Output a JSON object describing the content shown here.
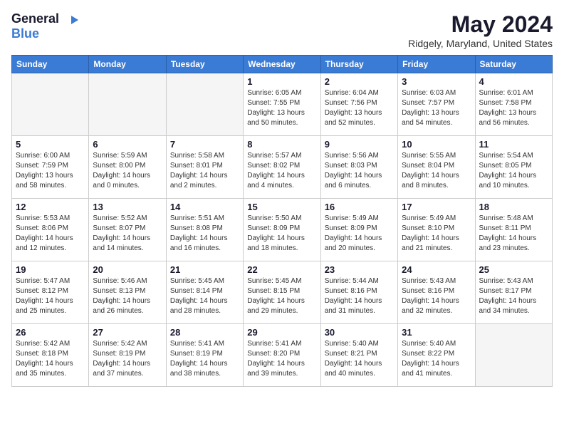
{
  "header": {
    "logo_general": "General",
    "logo_blue": "Blue",
    "title": "May 2024",
    "subtitle": "Ridgely, Maryland, United States"
  },
  "days_of_week": [
    "Sunday",
    "Monday",
    "Tuesday",
    "Wednesday",
    "Thursday",
    "Friday",
    "Saturday"
  ],
  "weeks": [
    [
      {
        "day": "",
        "sunrise": "",
        "sunset": "",
        "daylight": ""
      },
      {
        "day": "",
        "sunrise": "",
        "sunset": "",
        "daylight": ""
      },
      {
        "day": "",
        "sunrise": "",
        "sunset": "",
        "daylight": ""
      },
      {
        "day": "1",
        "sunrise": "Sunrise: 6:05 AM",
        "sunset": "Sunset: 7:55 PM",
        "daylight": "Daylight: 13 hours and 50 minutes."
      },
      {
        "day": "2",
        "sunrise": "Sunrise: 6:04 AM",
        "sunset": "Sunset: 7:56 PM",
        "daylight": "Daylight: 13 hours and 52 minutes."
      },
      {
        "day": "3",
        "sunrise": "Sunrise: 6:03 AM",
        "sunset": "Sunset: 7:57 PM",
        "daylight": "Daylight: 13 hours and 54 minutes."
      },
      {
        "day": "4",
        "sunrise": "Sunrise: 6:01 AM",
        "sunset": "Sunset: 7:58 PM",
        "daylight": "Daylight: 13 hours and 56 minutes."
      }
    ],
    [
      {
        "day": "5",
        "sunrise": "Sunrise: 6:00 AM",
        "sunset": "Sunset: 7:59 PM",
        "daylight": "Daylight: 13 hours and 58 minutes."
      },
      {
        "day": "6",
        "sunrise": "Sunrise: 5:59 AM",
        "sunset": "Sunset: 8:00 PM",
        "daylight": "Daylight: 14 hours and 0 minutes."
      },
      {
        "day": "7",
        "sunrise": "Sunrise: 5:58 AM",
        "sunset": "Sunset: 8:01 PM",
        "daylight": "Daylight: 14 hours and 2 minutes."
      },
      {
        "day": "8",
        "sunrise": "Sunrise: 5:57 AM",
        "sunset": "Sunset: 8:02 PM",
        "daylight": "Daylight: 14 hours and 4 minutes."
      },
      {
        "day": "9",
        "sunrise": "Sunrise: 5:56 AM",
        "sunset": "Sunset: 8:03 PM",
        "daylight": "Daylight: 14 hours and 6 minutes."
      },
      {
        "day": "10",
        "sunrise": "Sunrise: 5:55 AM",
        "sunset": "Sunset: 8:04 PM",
        "daylight": "Daylight: 14 hours and 8 minutes."
      },
      {
        "day": "11",
        "sunrise": "Sunrise: 5:54 AM",
        "sunset": "Sunset: 8:05 PM",
        "daylight": "Daylight: 14 hours and 10 minutes."
      }
    ],
    [
      {
        "day": "12",
        "sunrise": "Sunrise: 5:53 AM",
        "sunset": "Sunset: 8:06 PM",
        "daylight": "Daylight: 14 hours and 12 minutes."
      },
      {
        "day": "13",
        "sunrise": "Sunrise: 5:52 AM",
        "sunset": "Sunset: 8:07 PM",
        "daylight": "Daylight: 14 hours and 14 minutes."
      },
      {
        "day": "14",
        "sunrise": "Sunrise: 5:51 AM",
        "sunset": "Sunset: 8:08 PM",
        "daylight": "Daylight: 14 hours and 16 minutes."
      },
      {
        "day": "15",
        "sunrise": "Sunrise: 5:50 AM",
        "sunset": "Sunset: 8:09 PM",
        "daylight": "Daylight: 14 hours and 18 minutes."
      },
      {
        "day": "16",
        "sunrise": "Sunrise: 5:49 AM",
        "sunset": "Sunset: 8:09 PM",
        "daylight": "Daylight: 14 hours and 20 minutes."
      },
      {
        "day": "17",
        "sunrise": "Sunrise: 5:49 AM",
        "sunset": "Sunset: 8:10 PM",
        "daylight": "Daylight: 14 hours and 21 minutes."
      },
      {
        "day": "18",
        "sunrise": "Sunrise: 5:48 AM",
        "sunset": "Sunset: 8:11 PM",
        "daylight": "Daylight: 14 hours and 23 minutes."
      }
    ],
    [
      {
        "day": "19",
        "sunrise": "Sunrise: 5:47 AM",
        "sunset": "Sunset: 8:12 PM",
        "daylight": "Daylight: 14 hours and 25 minutes."
      },
      {
        "day": "20",
        "sunrise": "Sunrise: 5:46 AM",
        "sunset": "Sunset: 8:13 PM",
        "daylight": "Daylight: 14 hours and 26 minutes."
      },
      {
        "day": "21",
        "sunrise": "Sunrise: 5:45 AM",
        "sunset": "Sunset: 8:14 PM",
        "daylight": "Daylight: 14 hours and 28 minutes."
      },
      {
        "day": "22",
        "sunrise": "Sunrise: 5:45 AM",
        "sunset": "Sunset: 8:15 PM",
        "daylight": "Daylight: 14 hours and 29 minutes."
      },
      {
        "day": "23",
        "sunrise": "Sunrise: 5:44 AM",
        "sunset": "Sunset: 8:16 PM",
        "daylight": "Daylight: 14 hours and 31 minutes."
      },
      {
        "day": "24",
        "sunrise": "Sunrise: 5:43 AM",
        "sunset": "Sunset: 8:16 PM",
        "daylight": "Daylight: 14 hours and 32 minutes."
      },
      {
        "day": "25",
        "sunrise": "Sunrise: 5:43 AM",
        "sunset": "Sunset: 8:17 PM",
        "daylight": "Daylight: 14 hours and 34 minutes."
      }
    ],
    [
      {
        "day": "26",
        "sunrise": "Sunrise: 5:42 AM",
        "sunset": "Sunset: 8:18 PM",
        "daylight": "Daylight: 14 hours and 35 minutes."
      },
      {
        "day": "27",
        "sunrise": "Sunrise: 5:42 AM",
        "sunset": "Sunset: 8:19 PM",
        "daylight": "Daylight: 14 hours and 37 minutes."
      },
      {
        "day": "28",
        "sunrise": "Sunrise: 5:41 AM",
        "sunset": "Sunset: 8:19 PM",
        "daylight": "Daylight: 14 hours and 38 minutes."
      },
      {
        "day": "29",
        "sunrise": "Sunrise: 5:41 AM",
        "sunset": "Sunset: 8:20 PM",
        "daylight": "Daylight: 14 hours and 39 minutes."
      },
      {
        "day": "30",
        "sunrise": "Sunrise: 5:40 AM",
        "sunset": "Sunset: 8:21 PM",
        "daylight": "Daylight: 14 hours and 40 minutes."
      },
      {
        "day": "31",
        "sunrise": "Sunrise: 5:40 AM",
        "sunset": "Sunset: 8:22 PM",
        "daylight": "Daylight: 14 hours and 41 minutes."
      },
      {
        "day": "",
        "sunrise": "",
        "sunset": "",
        "daylight": ""
      }
    ]
  ]
}
